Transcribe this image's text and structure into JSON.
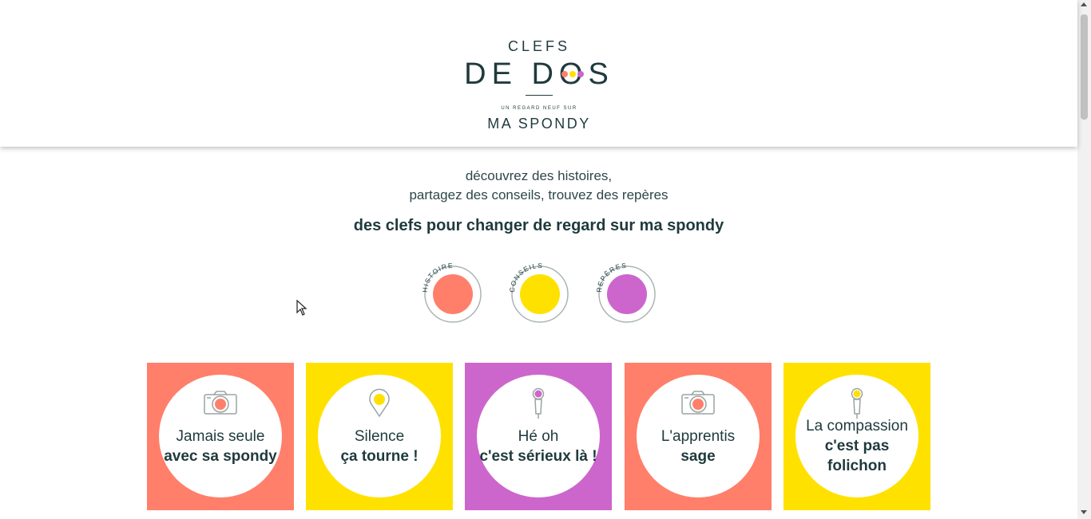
{
  "header": {
    "logo": {
      "line1": "CLEFS",
      "line2": "DE DOS",
      "subtitle": "UN REGARD NEUF SUR",
      "line3": "MA SPONDY"
    }
  },
  "intro": {
    "line1": "découvrez des histoires,",
    "line2": "partagez des conseils, trouvez des repères"
  },
  "tagline": "des clefs pour changer de regard sur ma spondy",
  "categories": [
    {
      "label": "HISTOIRES",
      "color": "#FF7F6B"
    },
    {
      "label": "CONSEILS",
      "color": "#FFE100"
    },
    {
      "label": "REPÈRES",
      "color": "#CC66CC"
    }
  ],
  "cards": [
    {
      "bg": "#FF7F6B",
      "icon": "camera-icon",
      "dot": "#FF7F6B",
      "normal": "Jamais seule",
      "bold": "avec sa spondy"
    },
    {
      "bg": "#FFE100",
      "icon": "location-pin-icon",
      "dot": "#FFE100",
      "normal": "Silence",
      "bold": "ça tourne !"
    },
    {
      "bg": "#CC66CC",
      "icon": "microphone-icon",
      "dot": "#CC66CC",
      "normal": "Hé oh",
      "bold": "c'est sérieux là !"
    },
    {
      "bg": "#FF7F6B",
      "icon": "camera-icon",
      "dot": "#FF7F6B",
      "normal": "L'apprentis",
      "bold": "sage"
    },
    {
      "bg": "#FFE100",
      "icon": "microphone-icon",
      "dot": "#FFE100",
      "normal": "La compassion",
      "bold": "c'est pas folichon"
    }
  ]
}
